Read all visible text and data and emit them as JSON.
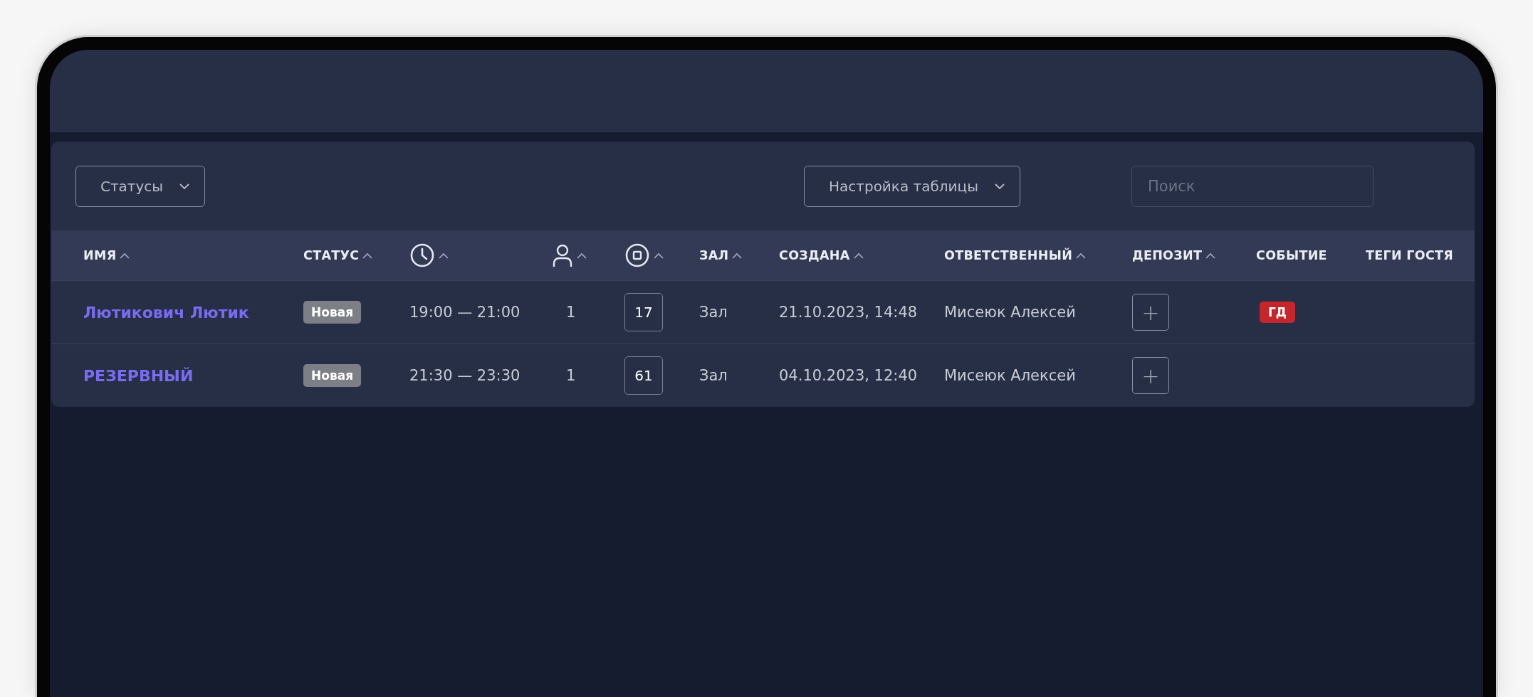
{
  "toolbar": {
    "status_filter": {
      "label": "Статусы"
    },
    "table_settings": {
      "label": "Настройка таблицы"
    },
    "search": {
      "placeholder": "Поиск"
    }
  },
  "table": {
    "columns": [
      {
        "kind": "text",
        "label": "ИМЯ",
        "sortable": true
      },
      {
        "kind": "text",
        "label": "СТАТУС",
        "sortable": true
      },
      {
        "kind": "time",
        "sortable": true
      },
      {
        "kind": "guests",
        "sortable": true
      },
      {
        "kind": "table",
        "sortable": true
      },
      {
        "kind": "text",
        "label": "ЗАЛ",
        "sortable": true
      },
      {
        "kind": "text",
        "label": "СОЗДАНА",
        "sortable": true
      },
      {
        "kind": "text",
        "label": "ОТВЕТСТВЕННЫЙ",
        "sortable": true
      },
      {
        "kind": "text",
        "label": "ДЕПОЗИТ",
        "sortable": true
      },
      {
        "kind": "text",
        "label": "СОБЫТИЕ",
        "sortable": false
      },
      {
        "kind": "text",
        "label": "ТЕГИ ГОСТЯ",
        "sortable": false
      }
    ],
    "rows": [
      {
        "name": "Лютикович Лютик",
        "status": "Новая",
        "time": "19:00 — 21:00",
        "guests": "1",
        "table": "17",
        "hall": "Зал",
        "created": "21.10.2023, 14:48",
        "responsible": "Мисеюк Алексей",
        "deposit": "+",
        "event": "ГД"
      },
      {
        "name": "РЕЗЕРВНЫЙ",
        "status": "Новая",
        "time": "21:30 — 23:30",
        "guests": "1",
        "table": "61",
        "hall": "Зал",
        "created": "04.10.2023, 12:40",
        "responsible": "Мисеюк Алексей",
        "deposit": "+"
      }
    ]
  }
}
